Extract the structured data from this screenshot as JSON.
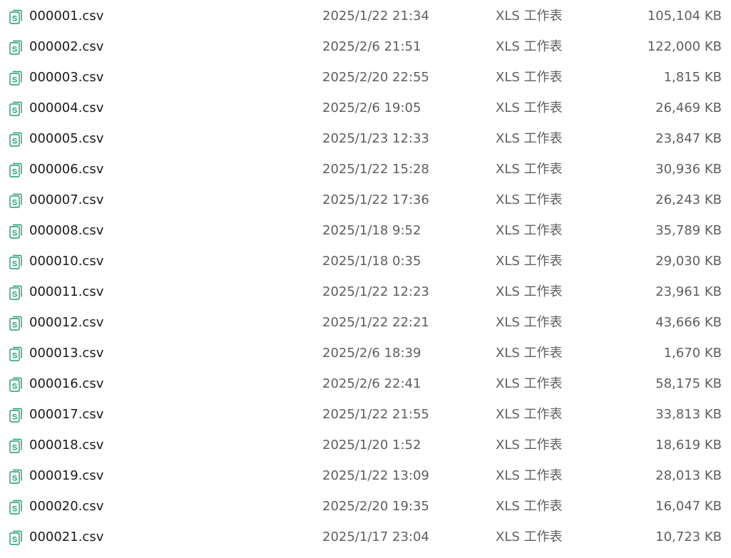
{
  "colors": {
    "icon_accent": "#1f9d6b",
    "name_text": "#1a1a1a",
    "meta_text": "#5e5e5e"
  },
  "file_icon": "spreadsheet-icon",
  "files": [
    {
      "name": "000001.csv",
      "date": "2025/1/22 21:34",
      "type": "XLS 工作表",
      "size": "105,104 KB"
    },
    {
      "name": "000002.csv",
      "date": "2025/2/6 21:51",
      "type": "XLS 工作表",
      "size": "122,000 KB"
    },
    {
      "name": "000003.csv",
      "date": "2025/2/20 22:55",
      "type": "XLS 工作表",
      "size": "1,815 KB"
    },
    {
      "name": "000004.csv",
      "date": "2025/2/6 19:05",
      "type": "XLS 工作表",
      "size": "26,469 KB"
    },
    {
      "name": "000005.csv",
      "date": "2025/1/23 12:33",
      "type": "XLS 工作表",
      "size": "23,847 KB"
    },
    {
      "name": "000006.csv",
      "date": "2025/1/22 15:28",
      "type": "XLS 工作表",
      "size": "30,936 KB"
    },
    {
      "name": "000007.csv",
      "date": "2025/1/22 17:36",
      "type": "XLS 工作表",
      "size": "26,243 KB"
    },
    {
      "name": "000008.csv",
      "date": "2025/1/18 9:52",
      "type": "XLS 工作表",
      "size": "35,789 KB"
    },
    {
      "name": "000010.csv",
      "date": "2025/1/18 0:35",
      "type": "XLS 工作表",
      "size": "29,030 KB"
    },
    {
      "name": "000011.csv",
      "date": "2025/1/22 12:23",
      "type": "XLS 工作表",
      "size": "23,961 KB"
    },
    {
      "name": "000012.csv",
      "date": "2025/1/22 22:21",
      "type": "XLS 工作表",
      "size": "43,666 KB"
    },
    {
      "name": "000013.csv",
      "date": "2025/2/6 18:39",
      "type": "XLS 工作表",
      "size": "1,670 KB"
    },
    {
      "name": "000016.csv",
      "date": "2025/2/6 22:41",
      "type": "XLS 工作表",
      "size": "58,175 KB"
    },
    {
      "name": "000017.csv",
      "date": "2025/1/22 21:55",
      "type": "XLS 工作表",
      "size": "33,813 KB"
    },
    {
      "name": "000018.csv",
      "date": "2025/1/20 1:52",
      "type": "XLS 工作表",
      "size": "18,619 KB"
    },
    {
      "name": "000019.csv",
      "date": "2025/1/22 13:09",
      "type": "XLS 工作表",
      "size": "28,013 KB"
    },
    {
      "name": "000020.csv",
      "date": "2025/2/20 19:35",
      "type": "XLS 工作表",
      "size": "16,047 KB"
    },
    {
      "name": "000021.csv",
      "date": "2025/1/17 23:04",
      "type": "XLS 工作表",
      "size": "10,723 KB"
    }
  ]
}
